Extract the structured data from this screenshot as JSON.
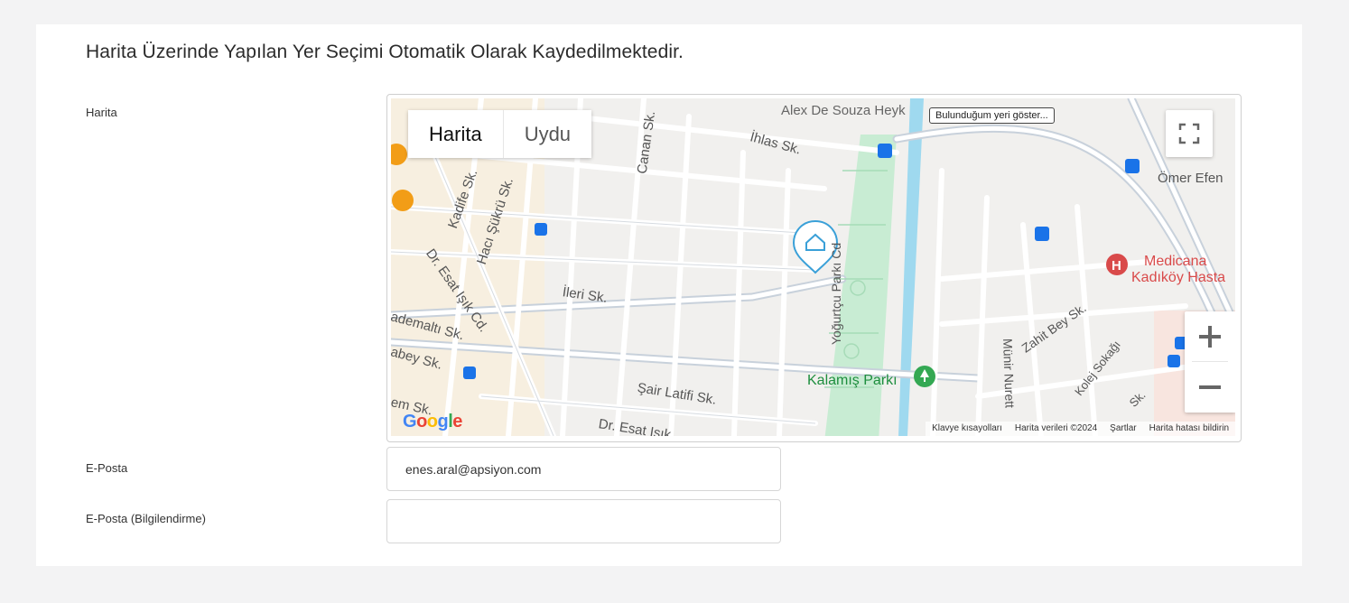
{
  "page": {
    "heading": "Harita Üzerinde Yapılan Yer Seçimi Otomatik Olarak Kaydedilmektedir."
  },
  "form": {
    "map_label": "Harita",
    "email_label": "E-Posta",
    "email_value": "enes.aral@apsiyon.com",
    "email_info_label": "E-Posta (Bilgilendirme)",
    "email_info_value": ""
  },
  "map": {
    "type_map": "Harita",
    "type_satellite": "Uydu",
    "tooltip": "Bulunduğum yeri göster...",
    "google_logo": "Google",
    "attribution": {
      "shortcuts": "Klavye kısayolları",
      "data": "Harita verileri ©2024",
      "terms": "Şartlar",
      "report": "Harita hatası bildirin"
    },
    "streets": [
      "Alex De Souza Heyk",
      "İhlas Sk.",
      "Canan Sk.",
      "Kadife Sk.",
      "Hacı Şükrü Sk.",
      "Dr. Esat Işık Cd.",
      "İleri Sk.",
      "ademaltı Sk.",
      "abey Sk.",
      "em Sk.",
      "Şair Latifi Sk.",
      "Dr. Esat Işık",
      "Yoğurtçu Parkı Cd",
      "Münir Nurett",
      "Zahit Bey Sk.",
      "Kolej Sokağı",
      "Ömer Efen",
      "Sk."
    ],
    "pois": {
      "park": "Kalamış Parkı",
      "hospital_line1": "Medicana",
      "hospital_line2": "Kadıköy Hasta"
    },
    "colors": {
      "park": "#c8ecd3",
      "road": "#ffffff",
      "water": "#9fd9ef",
      "hospital": "#d94a4a",
      "transit": "#1a73e8"
    }
  }
}
